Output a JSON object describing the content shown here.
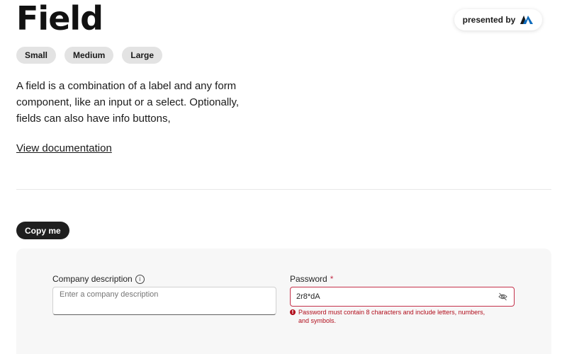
{
  "page": {
    "title": "Field",
    "description": "A field is a combination of a label and any form component, like an input or a select. Optionally, fields can also have info buttons,",
    "doc_link": "View documentation"
  },
  "badge": {
    "text": "presented by",
    "logo_icon": "brand-logo-icon",
    "logo_colors": [
      "#0f6cbd",
      "#1a1a1a"
    ]
  },
  "size_chips": [
    "Small",
    "Medium",
    "Large"
  ],
  "copy_button": "Copy me",
  "form": {
    "company": {
      "label": "Company description",
      "info_icon": "info-icon",
      "info_glyph": "i",
      "placeholder": "Enter a company description",
      "value": ""
    },
    "password": {
      "label": "Password",
      "required_mark": "*",
      "value": "2r8*dA",
      "toggle_icon": "eye-off-icon",
      "error_icon": "error-circle-icon",
      "error_glyph": "!",
      "error": "Password must contain 8 characters and include letters, numbers, and symbols."
    }
  },
  "colors": {
    "accent_dark": "#1f1f1f",
    "error": "#c4314b",
    "chip_bg": "#e3e3e3",
    "panel_bg": "#f7f7f7"
  }
}
